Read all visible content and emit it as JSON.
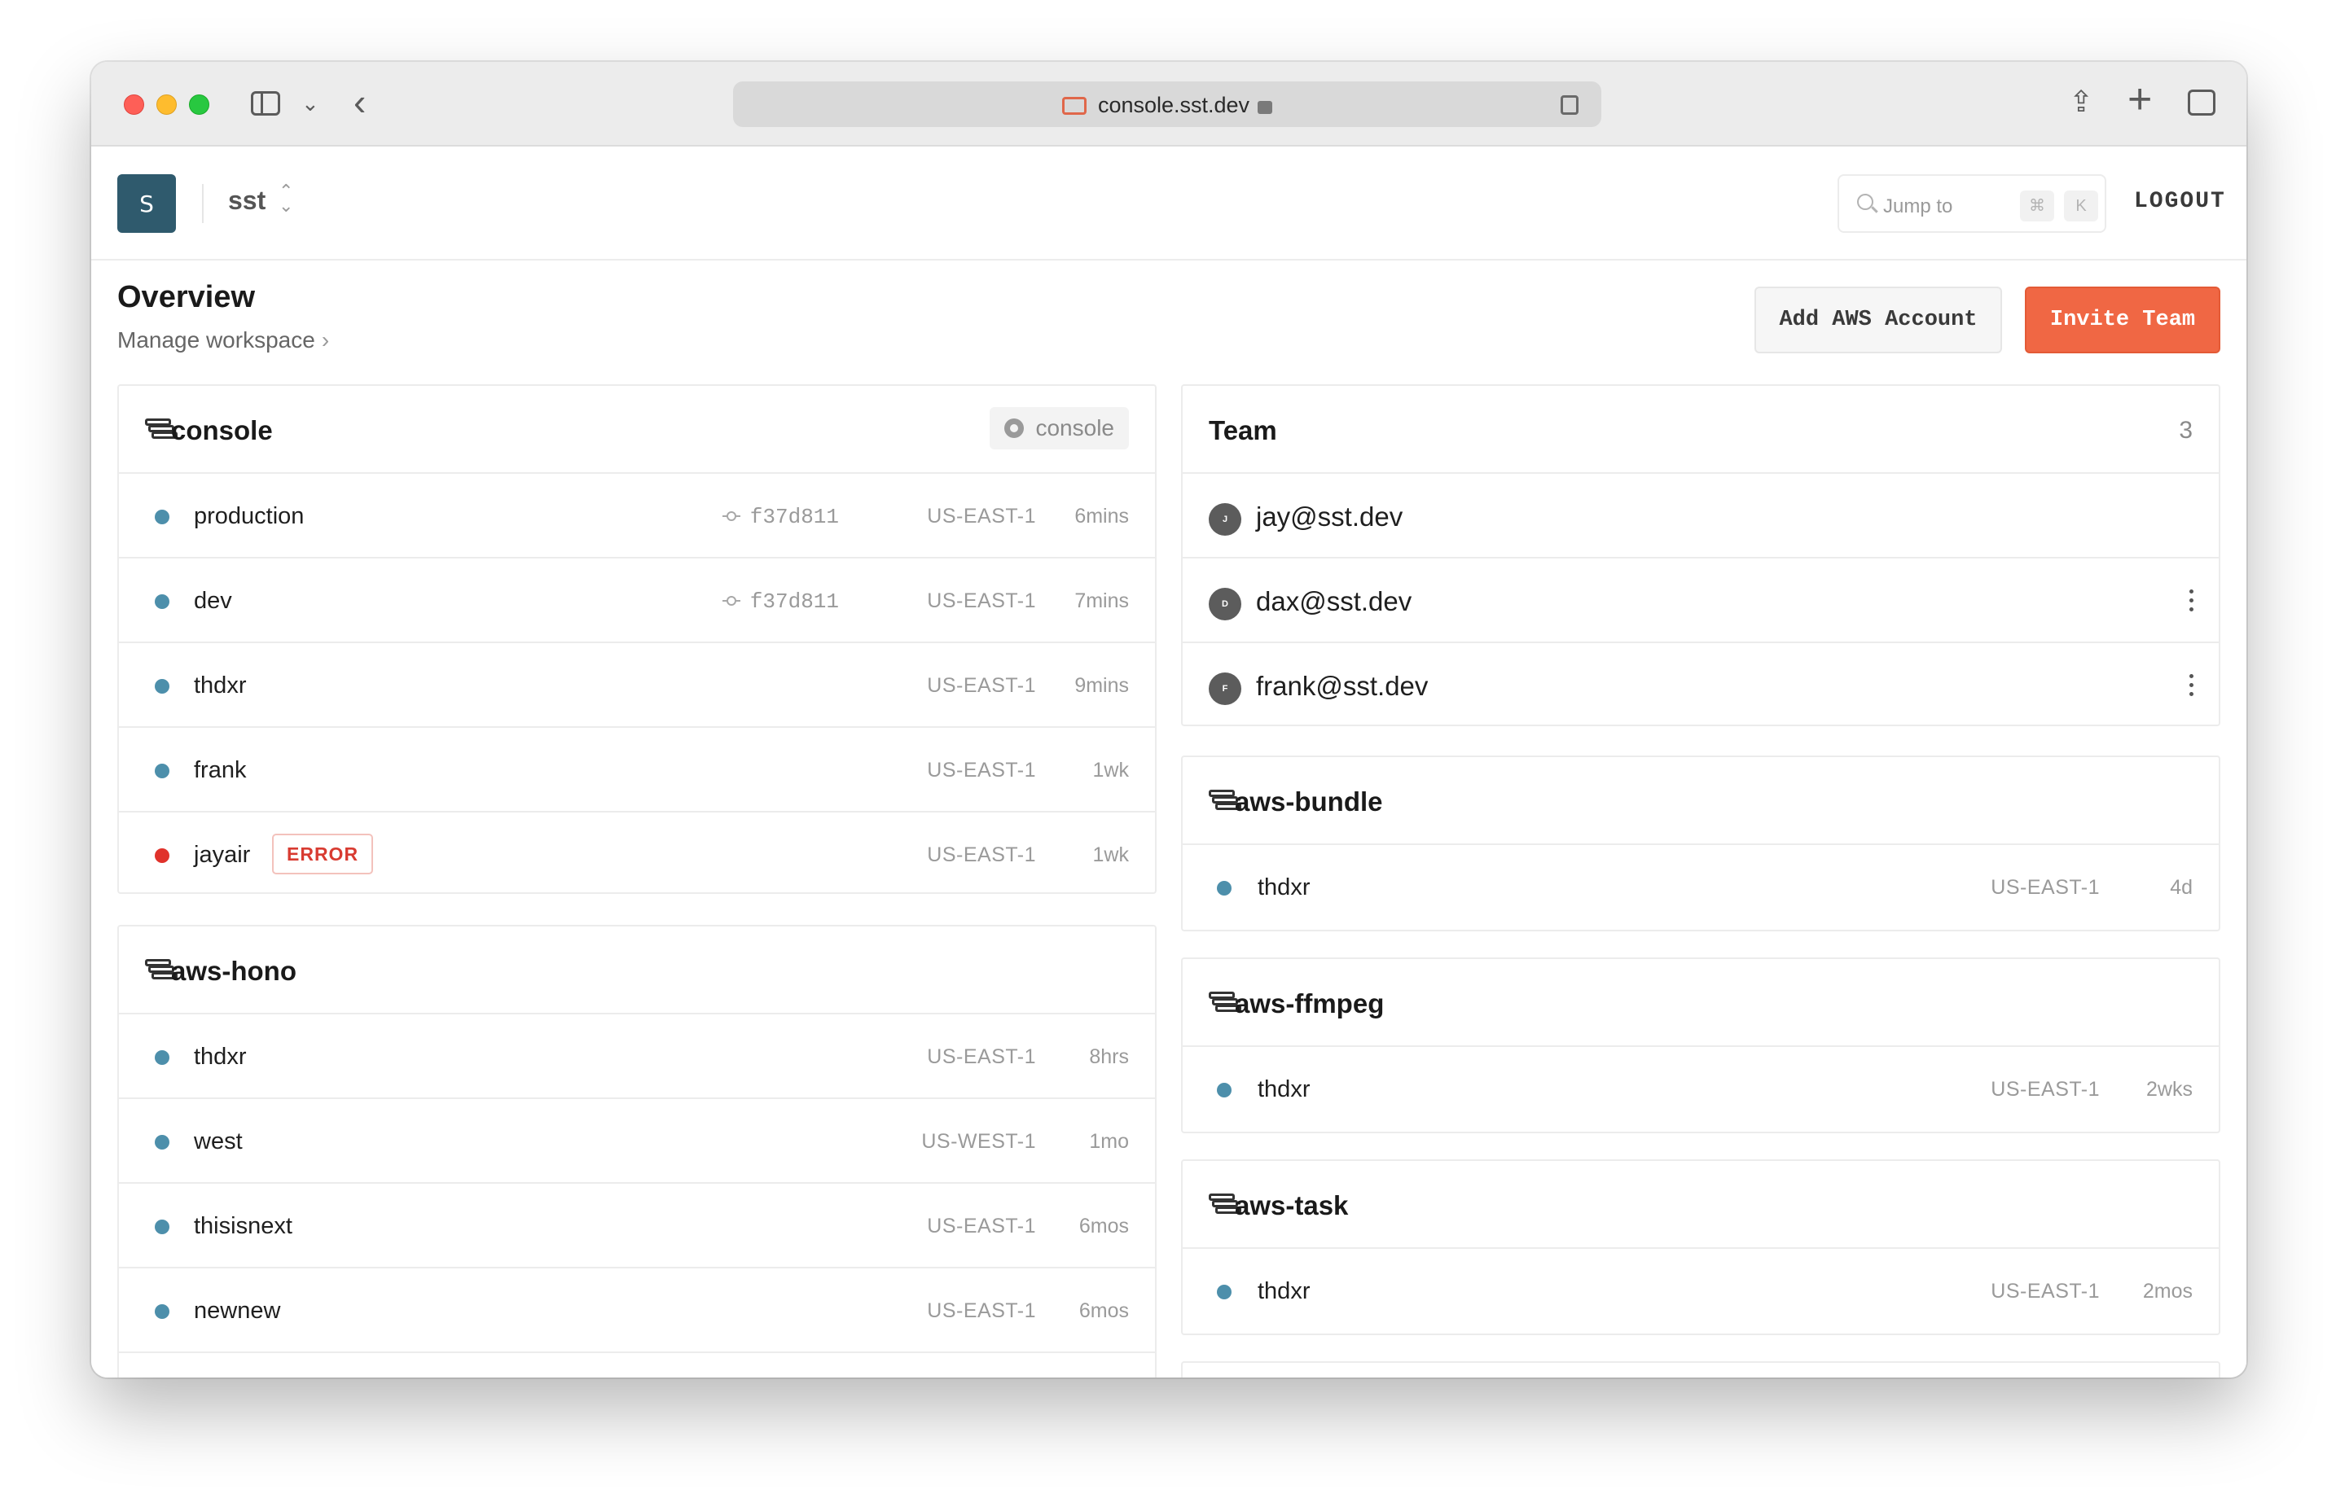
{
  "browser": {
    "url": "console.sst.dev"
  },
  "header": {
    "workspace_initial": "S",
    "workspace_name": "sst",
    "jump_placeholder": "Jump to",
    "kbd_cmd": "⌘",
    "kbd_key": "K",
    "logout_label": "LOGOUT"
  },
  "page": {
    "title": "Overview",
    "manage_link": "Manage workspace",
    "add_aws_label": "Add AWS Account",
    "invite_label": "Invite Team"
  },
  "apps_left": [
    {
      "name": "console",
      "repo": "console",
      "stages": [
        {
          "name": "production",
          "commit": "f37d811",
          "region": "US-EAST-1",
          "age": "6mins",
          "status": "ok"
        },
        {
          "name": "dev",
          "commit": "f37d811",
          "region": "US-EAST-1",
          "age": "7mins",
          "status": "ok"
        },
        {
          "name": "thdxr",
          "region": "US-EAST-1",
          "age": "9mins",
          "status": "ok"
        },
        {
          "name": "frank",
          "region": "US-EAST-1",
          "age": "1wk",
          "status": "ok"
        },
        {
          "name": "jayair",
          "badge": "ERROR",
          "region": "US-EAST-1",
          "age": "1wk",
          "status": "error"
        }
      ]
    },
    {
      "name": "aws-hono",
      "stages": [
        {
          "name": "thdxr",
          "region": "US-EAST-1",
          "age": "8hrs",
          "status": "ok"
        },
        {
          "name": "west",
          "region": "US-WEST-1",
          "age": "1mo",
          "status": "ok"
        },
        {
          "name": "thisisnext",
          "region": "US-EAST-1",
          "age": "6mos",
          "status": "ok"
        },
        {
          "name": "newnew",
          "region": "US-EAST-1",
          "age": "6mos",
          "status": "ok"
        }
      ]
    }
  ],
  "team": {
    "title": "Team",
    "count": "3",
    "members": [
      {
        "initial": "J",
        "email": "jay@sst.dev"
      },
      {
        "initial": "D",
        "email": "dax@sst.dev"
      },
      {
        "initial": "F",
        "email": "frank@sst.dev"
      }
    ]
  },
  "apps_right": [
    {
      "name": "aws-bundle",
      "stages": [
        {
          "name": "thdxr",
          "region": "US-EAST-1",
          "age": "4d",
          "status": "ok"
        }
      ]
    },
    {
      "name": "aws-ffmpeg",
      "stages": [
        {
          "name": "thdxr",
          "region": "US-EAST-1",
          "age": "2wks",
          "status": "ok"
        }
      ]
    },
    {
      "name": "aws-task",
      "stages": [
        {
          "name": "thdxr",
          "region": "US-EAST-1",
          "age": "2mos",
          "status": "ok"
        }
      ]
    }
  ],
  "colors": {
    "accent": "#f06744",
    "workspace_avatar": "#2f5a6d",
    "status_ok": "#4d8fab",
    "status_error": "#e0322b"
  },
  "icons": {
    "app": "stack-icon",
    "repo": "github-icon",
    "commit": "commit-icon",
    "search": "search-icon",
    "more": "kebab-icon"
  }
}
